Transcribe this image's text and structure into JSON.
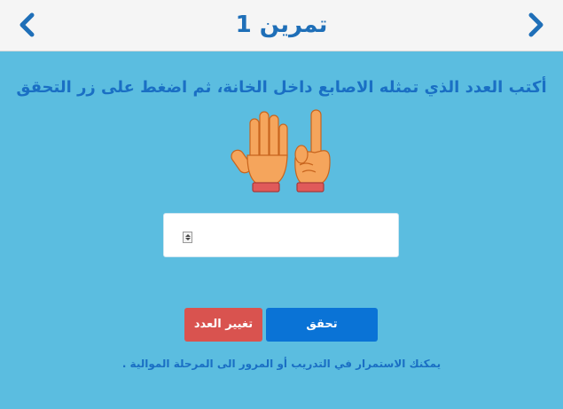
{
  "header": {
    "title": "تمرين 1",
    "prev_icon": "chevron-left-icon",
    "next_icon": "chevron-right-icon"
  },
  "instruction": "أكتب العدد الذي تمثله الاصابع داخل الخانة، ثم اضغط على زر التحقق",
  "image": {
    "icon": "hands-counting-icon",
    "fingers_shown": 6
  },
  "answer": {
    "value": "",
    "placeholder": ""
  },
  "buttons": {
    "check_label": "تحقق",
    "change_label": "تغيير العدد"
  },
  "footnote": "يمكنك الاستمرار في التدريب أو المرور الى المرحلة الموالية .",
  "colors": {
    "background": "#5bbde0",
    "header_bg": "#f5f5f5",
    "accent": "#1f6fb8",
    "check_button": "#0a73d6",
    "change_button": "#d9534f",
    "skin": "#f5a55c",
    "cuff": "#e05a5a"
  }
}
